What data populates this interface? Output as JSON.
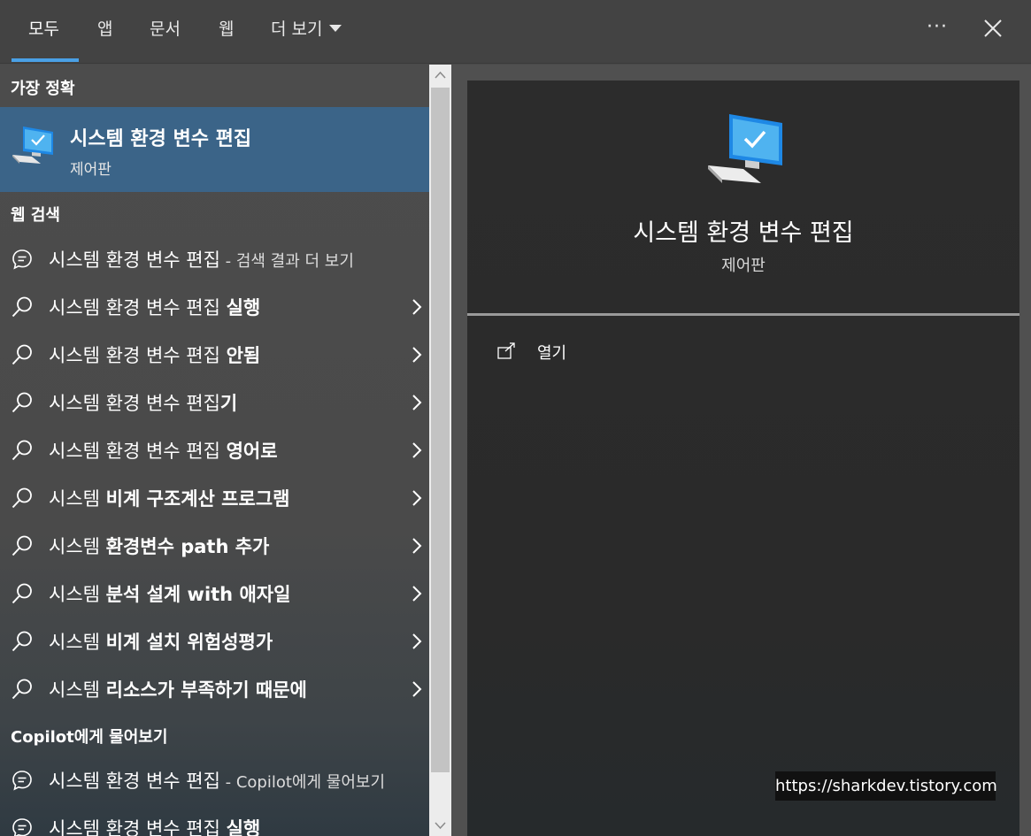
{
  "tabs": [
    {
      "label": "모두",
      "active": true
    },
    {
      "label": "앱"
    },
    {
      "label": "문서"
    },
    {
      "label": "웹"
    },
    {
      "label": "더 보기"
    }
  ],
  "header_actions": {
    "more_options": "···"
  },
  "sections": {
    "best_match": "가장 정확",
    "web_search": "웹 검색",
    "copilot": "Copilot에게 물어보기"
  },
  "best_match": {
    "title": "시스템 환경 변수 편집",
    "subtitle": "제어판"
  },
  "web_results": [
    {
      "prefix": "시스템 환경 변수 편집",
      "suffix": " - 검색 결과 더 보기",
      "icon": "chat-icon",
      "chevron": false
    },
    {
      "prefix": "시스템 환경 변수 편집 ",
      "bold": "실행",
      "icon": "search-icon",
      "chevron": true
    },
    {
      "prefix": "시스템 환경 변수 편집 ",
      "bold": "안됨",
      "icon": "search-icon",
      "chevron": true
    },
    {
      "prefix": "시스템 환경 변수 편집",
      "bold": "기",
      "icon": "search-icon",
      "chevron": true
    },
    {
      "prefix": "시스템 환경 변수 편집 ",
      "bold": "영어로",
      "icon": "search-icon",
      "chevron": true
    },
    {
      "prefix": "시스템 ",
      "bold": "비계 구조계산 프로그램",
      "icon": "search-icon",
      "chevron": true
    },
    {
      "prefix": "시스템 ",
      "bold": "환경변수 path 추가",
      "icon": "search-icon",
      "chevron": true
    },
    {
      "prefix": "시스템 ",
      "bold": "분석 설계 with 애자일",
      "icon": "search-icon",
      "chevron": true
    },
    {
      "prefix": "시스템 ",
      "bold": "비계 설치 위험성평가",
      "icon": "search-icon",
      "chevron": true
    },
    {
      "prefix": "시스템 ",
      "bold": "리소스가 부족하기 때문에",
      "icon": "search-icon",
      "chevron": true
    }
  ],
  "copilot_results": [
    {
      "prefix": "시스템 환경 변수 편집",
      "suffix": " - Copilot에게 물어보기",
      "icon": "chat-icon"
    },
    {
      "prefix": "시스템 환경 변수 편집 ",
      "bold": "실행",
      "icon": "chat-icon"
    }
  ],
  "preview": {
    "title": "시스템 환경 변수 편집",
    "subtitle": "제어판",
    "actions": [
      {
        "label": "열기",
        "icon": "open-external-icon"
      }
    ]
  },
  "watermark": "https://sharkdev.tistory.com",
  "colors": {
    "accent": "#4aa0e6",
    "selected_bg": "#3b6488",
    "preview_bg": "#2c2c2c"
  }
}
